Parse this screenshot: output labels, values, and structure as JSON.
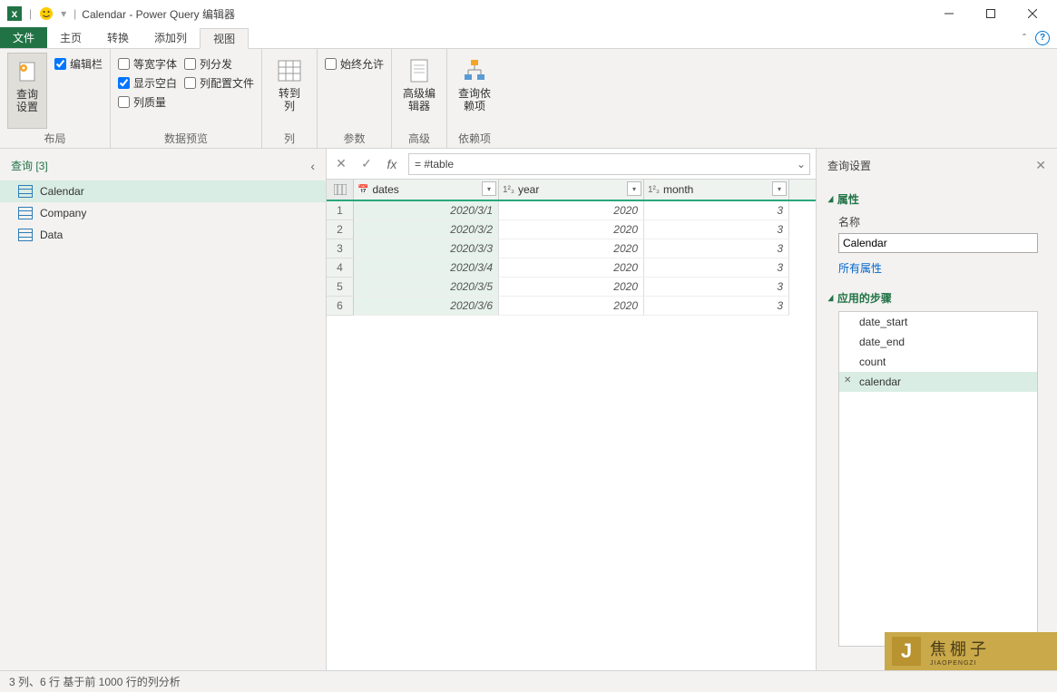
{
  "title": {
    "app": "Calendar - Power Query 编辑器",
    "qat_sep": "|",
    "dd": "▾"
  },
  "tabs": {
    "file": "文件",
    "home": "主页",
    "transform": "转换",
    "addcol": "添加列",
    "view": "视图"
  },
  "ribbon": {
    "layout_group": "布局",
    "query_settings_btn_l1": "查询",
    "query_settings_btn_l2": "设置",
    "formula_bar_chk": "编辑栏",
    "preview_group": "数据预览",
    "monospace_chk": "等宽字体",
    "show_whitespace_chk": "显示空白",
    "col_quality_chk": "列质量",
    "col_distribution_chk": "列分发",
    "col_profile_chk": "列配置文件",
    "column_group": "列",
    "goto_col_l1": "转到",
    "goto_col_l2": "列",
    "param_group": "参数",
    "always_allow_chk": "始终允许",
    "advanced_group": "高级",
    "adv_editor_l1": "高级编",
    "adv_editor_l2": "辑器",
    "dep_group": "依赖项",
    "dep_btn_l1": "查询依",
    "dep_btn_l2": "赖项"
  },
  "queries": {
    "header": "查询 [3]",
    "items": [
      {
        "label": "Calendar",
        "selected": true
      },
      {
        "label": "Company"
      },
      {
        "label": "Data"
      }
    ]
  },
  "formula": "= #table",
  "grid": {
    "columns": [
      {
        "name": "dates",
        "type": "date"
      },
      {
        "name": "year",
        "type": "num"
      },
      {
        "name": "month",
        "type": "num"
      }
    ],
    "rows": [
      {
        "n": "1",
        "dates": "2020/3/1",
        "year": "2020",
        "month": "3"
      },
      {
        "n": "2",
        "dates": "2020/3/2",
        "year": "2020",
        "month": "3"
      },
      {
        "n": "3",
        "dates": "2020/3/3",
        "year": "2020",
        "month": "3"
      },
      {
        "n": "4",
        "dates": "2020/3/4",
        "year": "2020",
        "month": "3"
      },
      {
        "n": "5",
        "dates": "2020/3/5",
        "year": "2020",
        "month": "3"
      },
      {
        "n": "6",
        "dates": "2020/3/6",
        "year": "2020",
        "month": "3"
      }
    ]
  },
  "settings": {
    "title": "查询设置",
    "prop_section": "属性",
    "name_label": "名称",
    "name_value": "Calendar",
    "all_props": "所有属性",
    "steps_section": "应用的步骤",
    "steps": [
      {
        "label": "date_start"
      },
      {
        "label": "date_end"
      },
      {
        "label": "count"
      },
      {
        "label": "calendar",
        "selected": true,
        "x": true
      }
    ]
  },
  "status": "3 列、6 行    基于前 1000 行的列分析",
  "watermark": {
    "letter": "J",
    "big": "焦棚子",
    "small": "JIAOPENGZI"
  }
}
